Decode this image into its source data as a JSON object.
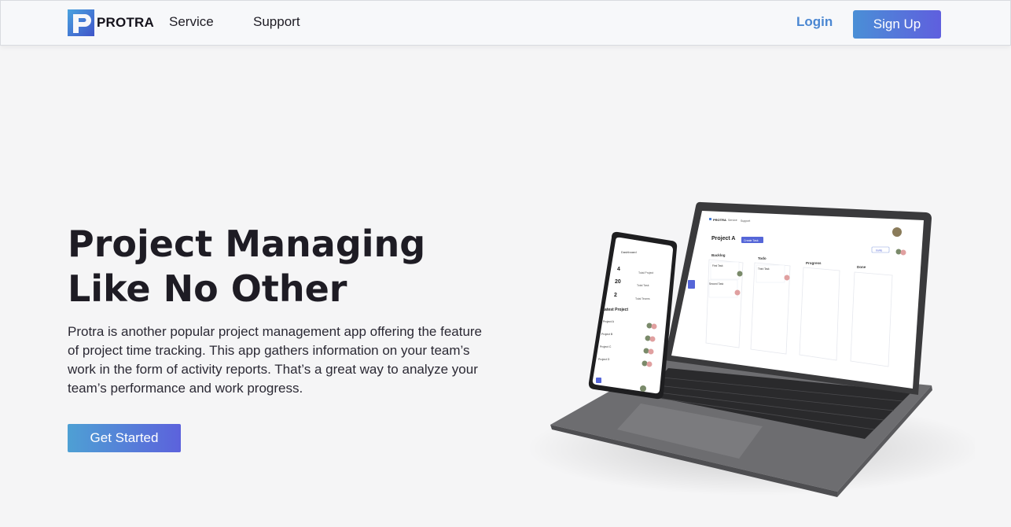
{
  "brand": {
    "name": "PROTRA",
    "logo_letter": "P"
  },
  "nav": {
    "links": [
      {
        "label": "Service"
      },
      {
        "label": "Support"
      }
    ],
    "login_label": "Login",
    "signup_label": "Sign Up"
  },
  "hero": {
    "title_line1": "Project Managing",
    "title_line2": "Like No Other",
    "description": "Protra is another popular project management app offering the feature of project time tracking. This app gathers information on your team’s work in the form of activity reports. That’s a great way to analyze your team’s performance and work progress.",
    "cta_label": "Get Started"
  },
  "mockup": {
    "laptop": {
      "brand": "PROTRA",
      "nav": [
        "Service",
        "Support"
      ],
      "project_title": "Project A",
      "create_task_label": "Create Task",
      "invite_label": "Invite",
      "columns": [
        "Backlog",
        "Todo",
        "Progress",
        "Done"
      ],
      "cards": {
        "backlog": [
          "First Task",
          "Second Task"
        ],
        "todo": [
          "Third Task"
        ]
      }
    },
    "phone": {
      "title": "Dashboard",
      "stats": [
        {
          "value": "4",
          "label": "Total Project"
        },
        {
          "value": "20",
          "label": "Total Task"
        },
        {
          "value": "2",
          "label": "Total Teams"
        }
      ],
      "latest_title": "Latest Project",
      "projects": [
        "Project A",
        "Project B",
        "Project C",
        "Project D"
      ]
    }
  },
  "colors": {
    "page_bg": "#f5f5f6",
    "nav_bg": "#f7f8fa",
    "login_text": "#4b87d2",
    "gradient_start": "#4a8fd6",
    "gradient_end": "#5f5fde",
    "logo_blue_light": "#4aa3df",
    "logo_blue_dark": "#3f54c9"
  }
}
